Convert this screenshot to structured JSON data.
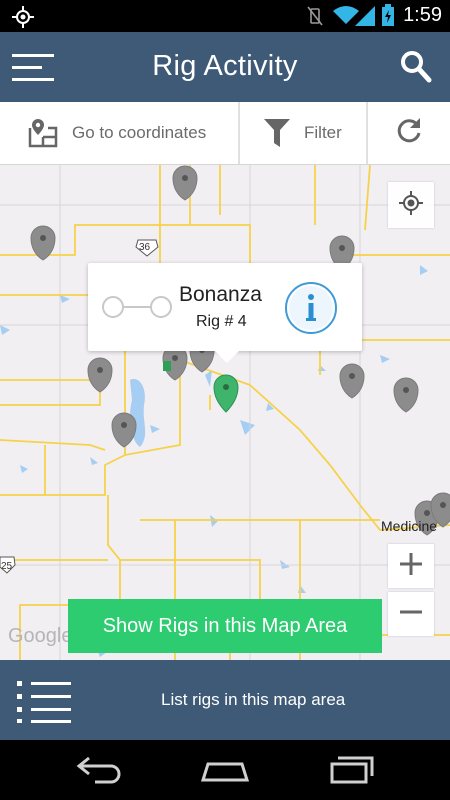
{
  "status_bar": {
    "time": "1:59"
  },
  "app_bar": {
    "title": "Rig Activity"
  },
  "toolbar": {
    "coordinates_label": "Go to coordinates",
    "filter_label": "Filter"
  },
  "map": {
    "road_labels": [
      "36",
      "25"
    ],
    "place_label": "Medicine",
    "watermark": "Google",
    "popup": {
      "name": "Bonanza",
      "subtitle": "Rig # 4"
    },
    "show_rigs_label": "Show Rigs in this Map Area"
  },
  "bottom_bar": {
    "list_label": "List rigs in this map area"
  },
  "colors": {
    "app_bar": "#3e5a76",
    "accent_green": "#2ecc71",
    "selected_marker": "#3fb56c",
    "marker_gray": "#8c8c8c",
    "info_blue": "#2a8fd1",
    "road_yellow": "#f5d24a"
  }
}
